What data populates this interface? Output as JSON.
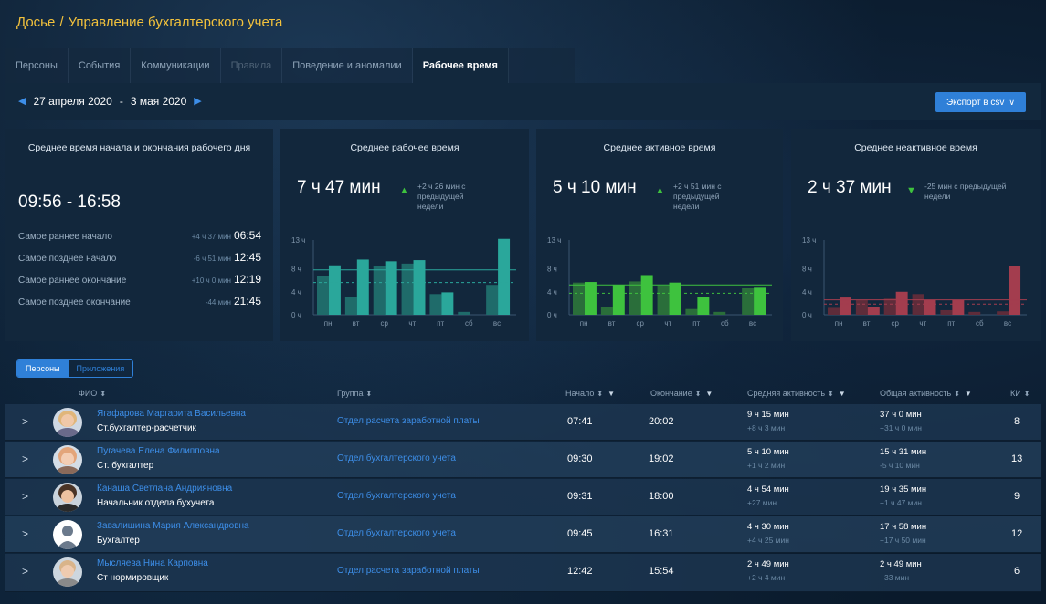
{
  "breadcrumb": {
    "root": "Досье",
    "separator": "/",
    "current": "Управление бухгалтерского учета"
  },
  "tabs": [
    {
      "label": "Персоны",
      "state": "normal"
    },
    {
      "label": "События",
      "state": "normal"
    },
    {
      "label": "Коммуникации",
      "state": "normal"
    },
    {
      "label": "Правила",
      "state": "disabled"
    },
    {
      "label": "Поведение и аномалии",
      "state": "normal"
    },
    {
      "label": "Рабочее время",
      "state": "active"
    }
  ],
  "date_range": {
    "start": "27 апреля 2020",
    "dash": "-",
    "end": "3 мая 2020"
  },
  "export_label": "Экспорт в csv",
  "cards": {
    "start_end": {
      "title": "Среднее время начала и окончания рабочего дня",
      "range": "09:56 - 16:58",
      "rows": [
        {
          "label": "Самое раннее начало",
          "delta": "+4 ч 37 мин",
          "time": "06:54"
        },
        {
          "label": "Самое позднее начало",
          "delta": "-6 ч 51 мин",
          "time": "12:45"
        },
        {
          "label": "Самое раннее окончание",
          "delta": "+10 ч 0 мин",
          "time": "12:19"
        },
        {
          "label": "Самое позднее окончание",
          "delta": "-44 мин",
          "time": "21:45"
        }
      ]
    },
    "work": {
      "title": "Среднее рабочее время",
      "value": "7 ч 47 мин",
      "trend": "+2 ч 26 мин с предыдущей недели"
    },
    "active": {
      "title": "Среднее активное время",
      "value": "5 ч 10 мин",
      "trend": "+2 ч 51 мин с предыдущей недели"
    },
    "inactive": {
      "title": "Среднее неактивное время",
      "value": "2 ч 37 мин",
      "trend": "-25 мин с предыдущей недели"
    }
  },
  "colors": {
    "accent": "#2f80d8",
    "work": "#2aa79b",
    "active": "#3ec23e",
    "inactive": "#a33d4e",
    "title": "#f3c23c"
  },
  "chart_data": [
    {
      "type": "bar",
      "title": "Среднее рабочее время",
      "categories": [
        "пн",
        "вт",
        "ср",
        "чт",
        "пт",
        "сб",
        "вс"
      ],
      "y_ticks": [
        "13 ч",
        "8 ч",
        "4 ч",
        "0 ч"
      ],
      "ylim": [
        0,
        13
      ],
      "series": [
        {
          "values": [
            8.6,
            9.6,
            9.3,
            9.5,
            3.9,
            0,
            13.2
          ]
        },
        {
          "values": [
            6.8,
            3.1,
            8.4,
            8.9,
            3.6,
            0.5,
            5.2
          ]
        }
      ],
      "average_line": 7.8
    },
    {
      "type": "bar",
      "title": "Среднее активное время",
      "categories": [
        "пн",
        "вт",
        "ср",
        "чт",
        "пт",
        "сб",
        "вс"
      ],
      "y_ticks": [
        "13 ч",
        "8 ч",
        "4 ч",
        "0 ч"
      ],
      "ylim": [
        0,
        13
      ],
      "series": [
        {
          "values": [
            5.7,
            5.2,
            6.9,
            5.6,
            3.1,
            0,
            4.7
          ]
        },
        {
          "values": [
            5.6,
            1.3,
            5.8,
            5.1,
            1.0,
            0.5,
            4.6
          ]
        }
      ],
      "average_line": 5.2
    },
    {
      "type": "bar",
      "title": "Среднее неактивное время",
      "categories": [
        "пн",
        "вт",
        "ср",
        "чт",
        "пт",
        "сб",
        "вс"
      ],
      "y_ticks": [
        "13 ч",
        "8 ч",
        "4 ч",
        "0 ч"
      ],
      "ylim": [
        0,
        13
      ],
      "series": [
        {
          "values": [
            3.0,
            1.4,
            4.0,
            2.6,
            2.6,
            0,
            8.5
          ]
        },
        {
          "values": [
            1.2,
            2.6,
            2.8,
            3.6,
            0.8,
            0.5,
            0.6
          ]
        }
      ],
      "average_line": 2.6
    }
  ],
  "list_toggle": {
    "persons": "Персоны",
    "apps": "Приложения"
  },
  "table": {
    "headers": {
      "name": "ФИО",
      "group": "Группа",
      "start": "Начало",
      "end": "Окончание",
      "avg_activity": "Средняя активность",
      "total_activity": "Общая активность",
      "count": "КИ"
    },
    "rows": [
      {
        "name": "Ягафарова Маргарита Васильевна",
        "role": "Ст.бухгалтер-расчетчик",
        "group": "Отдел расчета заработной платы",
        "start": "07:41",
        "end": "20:02",
        "avg": "9 ч 15 мин",
        "avg_delta": "+8 ч 3 мин",
        "total": "37 ч 0 мин",
        "total_delta": "+31 ч 0 мин",
        "count": "8"
      },
      {
        "name": "Пугачева Елена Филипповна",
        "role": "Ст. бухгалтер",
        "group": "Отдел бухгалтерского учета",
        "start": "09:30",
        "end": "19:02",
        "avg": "5 ч 10 мин",
        "avg_delta": "+1 ч 2 мин",
        "total": "15 ч 31 мин",
        "total_delta": "-5 ч 10 мин",
        "count": "13"
      },
      {
        "name": "Канаша Светлана Андрияновна",
        "role": "Начальник отдела бухучета",
        "group": "Отдел бухгалтерского учета",
        "start": "09:31",
        "end": "18:00",
        "avg": "4 ч 54 мин",
        "avg_delta": "+27 мин",
        "total": "19 ч 35 мин",
        "total_delta": "+1 ч 47 мин",
        "count": "9"
      },
      {
        "name": "Завалишина Мария Александровна",
        "role": "Бухгалтер",
        "group": "Отдел бухгалтерского учета",
        "start": "09:45",
        "end": "16:31",
        "avg": "4 ч 30 мин",
        "avg_delta": "+4 ч 25 мин",
        "total": "17 ч 58 мин",
        "total_delta": "+17 ч 50 мин",
        "count": "12"
      },
      {
        "name": "Мысляева Нина Карповна",
        "role": "Ст нормировщик",
        "group": "Отдел расчета заработной платы",
        "start": "12:42",
        "end": "15:54",
        "avg": "2 ч 49 мин",
        "avg_delta": "+2 ч 4 мин",
        "total": "2 ч 49 мин",
        "total_delta": "+33 мин",
        "count": "6"
      }
    ]
  }
}
